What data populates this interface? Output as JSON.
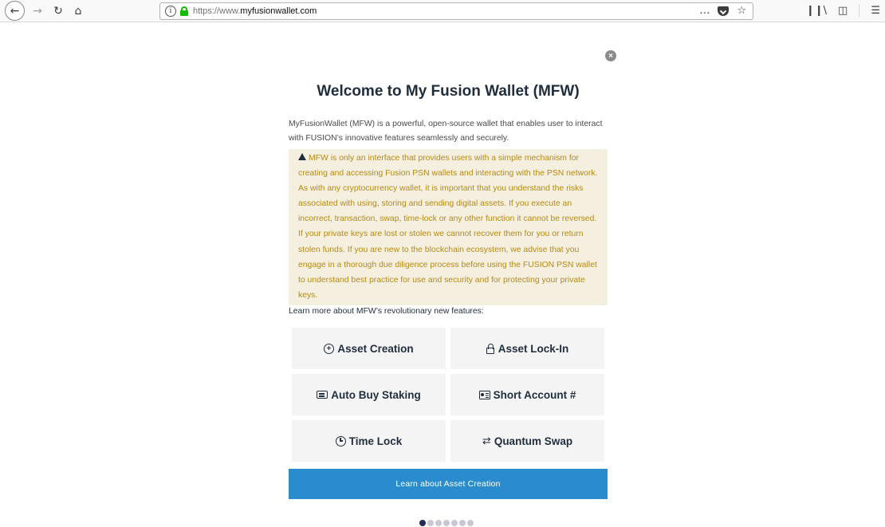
{
  "browser": {
    "url_prefix": "https://www.",
    "url_domain": "myfusionwallet.com",
    "url_overflow_icon": "…",
    "bookmark_star_icon": "☆"
  },
  "page": {
    "close_icon": "×",
    "title": "Welcome to My Fusion Wallet (MFW)",
    "intro": "MyFusionWallet (MFW) is a powerful, open-source wallet that enables user to interact with FUSION’s innovative features seamlessly and securely.",
    "warning": "MFW is only an interface that provides users with a simple mechanism for creating and accessing Fusion PSN wallets and interacting with the PSN network. As with any cryptocurrency wallet, it is important that you understand the risks associated with using, storing and sending digital assets. If you execute an incorrect, transaction, swap, time-lock or any other function it cannot be reversed. If your private keys are lost or stolen we cannot recover them for you or return stolen funds. If you are new to the blockchain ecosystem, we advise that you engage in a thorough due diligence process before using the FUSION PSN wallet to understand best practice for use and security and for protecting your private keys.",
    "learn_more": "Learn more about MFW’s revolutionary new features:",
    "features": [
      {
        "label": "Asset Creation",
        "icon": "plus-circle-icon"
      },
      {
        "label": "Asset Lock-In",
        "icon": "lock-icon"
      },
      {
        "label": "Auto Buy Staking",
        "icon": "card-icon"
      },
      {
        "label": "Short Account #",
        "icon": "id-card-icon"
      },
      {
        "label": "Time Lock",
        "icon": "clock-icon"
      },
      {
        "label": "Quantum Swap",
        "icon": "swap-icon"
      }
    ],
    "cta_label": "Learn about Asset Creation",
    "pagination": {
      "total": 7,
      "active": 1
    }
  },
  "colors": {
    "warning_bg": "#f5efe0",
    "warning_text": "#b78a14",
    "cta_bg": "#2b8ccd",
    "tile_bg": "#f4f4f5",
    "heading": "#1f2d3d"
  }
}
